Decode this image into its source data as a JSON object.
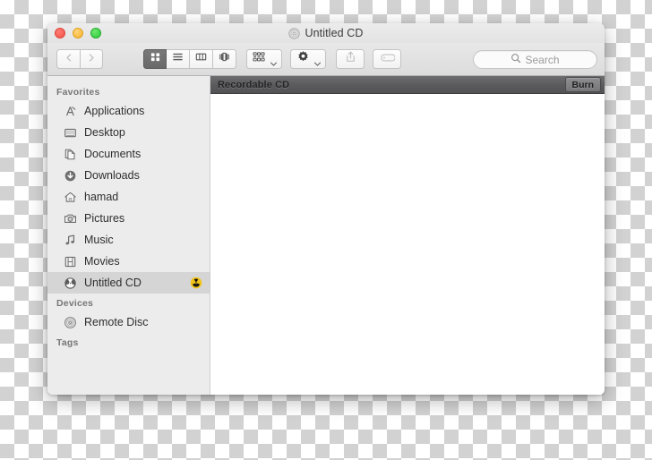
{
  "window": {
    "title": "Untitled CD",
    "title_icon": "cd-disc-icon",
    "traffic_lights": {
      "close_label": "close",
      "minimize_label": "minimize",
      "zoom_label": "zoom",
      "close_color": "#ef5348",
      "minimize_color": "#f7b32b",
      "zoom_color": "#2bc93a"
    }
  },
  "toolbar": {
    "back_label": "Back",
    "back_icon": "chevron-left-icon",
    "forward_label": "Forward",
    "forward_icon": "chevron-right-icon",
    "view_modes": [
      {
        "label": "Icon View",
        "icon": "grid-view-icon",
        "active": true
      },
      {
        "label": "List View",
        "icon": "list-view-icon",
        "active": false
      },
      {
        "label": "Column View",
        "icon": "column-view-icon",
        "active": false
      },
      {
        "label": "Cover Flow",
        "icon": "coverflow-view-icon",
        "active": false
      }
    ],
    "arrange": {
      "label": "Arrange",
      "icon": "arrange-icon",
      "chevron": "chevron-down-icon"
    },
    "action": {
      "label": "Action",
      "icon": "gear-icon",
      "chevron": "chevron-down-icon"
    },
    "share": {
      "label": "Share",
      "icon": "share-icon"
    },
    "tags": {
      "label": "Tags",
      "icon": "tag-icon"
    },
    "search": {
      "placeholder": "Search",
      "value": "",
      "icon": "search-icon"
    }
  },
  "sidebar": {
    "sections": [
      {
        "header": "Favorites",
        "items": [
          {
            "label": "Applications",
            "icon": "applications-icon",
            "selected": false,
            "badge": null
          },
          {
            "label": "Desktop",
            "icon": "desktop-icon",
            "selected": false,
            "badge": null
          },
          {
            "label": "Documents",
            "icon": "documents-icon",
            "selected": false,
            "badge": null
          },
          {
            "label": "Downloads",
            "icon": "downloads-icon",
            "selected": false,
            "badge": null
          },
          {
            "label": "hamad",
            "icon": "home-icon",
            "selected": false,
            "badge": null
          },
          {
            "label": "Pictures",
            "icon": "pictures-icon",
            "selected": false,
            "badge": null
          },
          {
            "label": "Music",
            "icon": "music-icon",
            "selected": false,
            "badge": null
          },
          {
            "label": "Movies",
            "icon": "movies-icon",
            "selected": false,
            "badge": null
          },
          {
            "label": "Untitled CD",
            "icon": "burn-disc-icon",
            "selected": true,
            "badge": "burn-badge-icon"
          }
        ]
      },
      {
        "header": "Devices",
        "items": [
          {
            "label": "Remote Disc",
            "icon": "remote-disc-icon",
            "selected": false,
            "badge": null
          }
        ]
      },
      {
        "header": "Tags",
        "items": []
      }
    ]
  },
  "content": {
    "burn_bar": {
      "title": "Recordable CD",
      "burn_button_label": "Burn"
    },
    "files": []
  }
}
